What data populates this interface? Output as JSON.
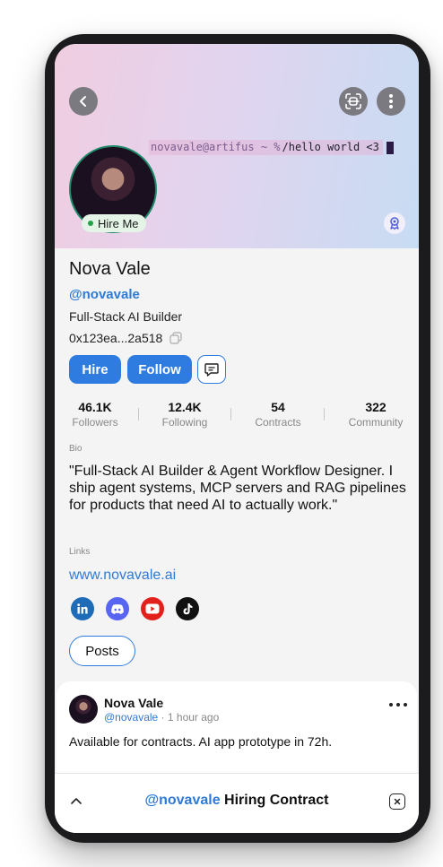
{
  "header": {
    "back_icon": "chevron-left-icon",
    "scan_icon": "scan-icon",
    "more_icon": "more-vertical-icon",
    "terminal_prompt": "novavale@artifus ~ %",
    "terminal_command": "/hello world <3",
    "hire_tag": "Hire Me",
    "badge_icon": "award-icon"
  },
  "profile": {
    "name": "Nova Vale",
    "handle": "@novavale",
    "role": "Full-Stack AI Builder",
    "wallet": "0x123ea...2a518",
    "copy_icon": "copy-icon"
  },
  "actions": {
    "hire": "Hire",
    "follow": "Follow",
    "chat_icon": "message-icon"
  },
  "stats": [
    {
      "value": "46.1K",
      "label": "Followers"
    },
    {
      "value": "12.4K",
      "label": "Following"
    },
    {
      "value": "54",
      "label": "Contracts"
    },
    {
      "value": "322",
      "label": "Community"
    }
  ],
  "bio": {
    "label": "Bio",
    "text": "\"Full-Stack AI Builder & Agent Workflow Designer. I ship agent systems, MCP servers and RAG pipelines for products that need AI to actually work.\""
  },
  "links": {
    "label": "Links",
    "url": "www.novavale.ai",
    "socials": [
      "linkedin-icon",
      "discord-icon",
      "youtube-icon",
      "tiktok-icon"
    ]
  },
  "tabs": {
    "posts": "Posts"
  },
  "post": {
    "author": "Nova Vale",
    "handle": "@novavale",
    "time": " · 1 hour ago",
    "text": "Available for contracts. AI app prototype in 72h."
  },
  "bottom_bar": {
    "handle": "@novavale",
    "title": "Hiring Contract"
  },
  "colors": {
    "accent": "#2f7ce0",
    "status_green": "#22a34a"
  }
}
